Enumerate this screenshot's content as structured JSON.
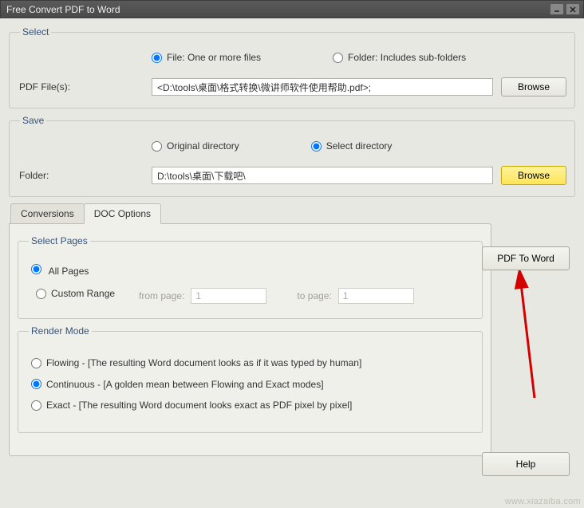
{
  "window": {
    "title": "Free Convert PDF to Word"
  },
  "select_group": {
    "legend": "Select",
    "radio_file": "File:  One or more files",
    "radio_folder": "Folder: Includes sub-folders",
    "file_label": "PDF File(s):",
    "file_value": "<D:\\tools\\桌面\\格式转换\\微讲师软件使用帮助.pdf>;",
    "browse": "Browse"
  },
  "save_group": {
    "legend": "Save",
    "radio_original": "Original directory",
    "radio_select": "Select directory",
    "folder_label": "Folder:",
    "folder_value": "D:\\tools\\桌面\\下载吧\\",
    "browse": "Browse"
  },
  "tabs": {
    "conversions": "Conversions",
    "doc_options": "DOC Options"
  },
  "select_pages": {
    "legend": "Select Pages",
    "all": "All Pages",
    "custom": "Custom Range",
    "from_label": "from page:",
    "from_value": "1",
    "to_label": "to page:",
    "to_value": "1"
  },
  "render_mode": {
    "legend": "Render Mode",
    "flowing": "Flowing - [The resulting Word document looks as if it was typed by human]",
    "continuous": "Continuous - [A golden mean between Flowing and Exact modes]",
    "exact": "Exact - [The resulting Word document looks exact as PDF pixel by pixel]"
  },
  "buttons": {
    "pdf_to_word": "PDF To Word",
    "help": "Help"
  },
  "watermark": "www.xiazaiba.com"
}
